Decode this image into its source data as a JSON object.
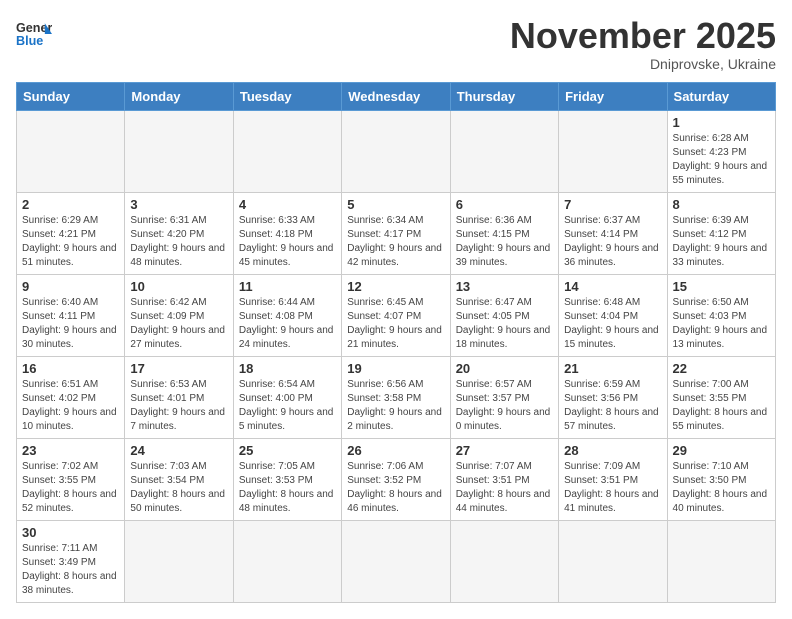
{
  "header": {
    "logo_line1": "General",
    "logo_line2": "Blue",
    "month_title": "November 2025",
    "location": "Dniprovske, Ukraine"
  },
  "weekdays": [
    "Sunday",
    "Monday",
    "Tuesday",
    "Wednesday",
    "Thursday",
    "Friday",
    "Saturday"
  ],
  "days": [
    {
      "date": "",
      "info": ""
    },
    {
      "date": "",
      "info": ""
    },
    {
      "date": "",
      "info": ""
    },
    {
      "date": "",
      "info": ""
    },
    {
      "date": "",
      "info": ""
    },
    {
      "date": "",
      "info": ""
    },
    {
      "date": "1",
      "info": "Sunrise: 6:28 AM\nSunset: 4:23 PM\nDaylight: 9 hours and 55 minutes."
    },
    {
      "date": "2",
      "info": "Sunrise: 6:29 AM\nSunset: 4:21 PM\nDaylight: 9 hours and 51 minutes."
    },
    {
      "date": "3",
      "info": "Sunrise: 6:31 AM\nSunset: 4:20 PM\nDaylight: 9 hours and 48 minutes."
    },
    {
      "date": "4",
      "info": "Sunrise: 6:33 AM\nSunset: 4:18 PM\nDaylight: 9 hours and 45 minutes."
    },
    {
      "date": "5",
      "info": "Sunrise: 6:34 AM\nSunset: 4:17 PM\nDaylight: 9 hours and 42 minutes."
    },
    {
      "date": "6",
      "info": "Sunrise: 6:36 AM\nSunset: 4:15 PM\nDaylight: 9 hours and 39 minutes."
    },
    {
      "date": "7",
      "info": "Sunrise: 6:37 AM\nSunset: 4:14 PM\nDaylight: 9 hours and 36 minutes."
    },
    {
      "date": "8",
      "info": "Sunrise: 6:39 AM\nSunset: 4:12 PM\nDaylight: 9 hours and 33 minutes."
    },
    {
      "date": "9",
      "info": "Sunrise: 6:40 AM\nSunset: 4:11 PM\nDaylight: 9 hours and 30 minutes."
    },
    {
      "date": "10",
      "info": "Sunrise: 6:42 AM\nSunset: 4:09 PM\nDaylight: 9 hours and 27 minutes."
    },
    {
      "date": "11",
      "info": "Sunrise: 6:44 AM\nSunset: 4:08 PM\nDaylight: 9 hours and 24 minutes."
    },
    {
      "date": "12",
      "info": "Sunrise: 6:45 AM\nSunset: 4:07 PM\nDaylight: 9 hours and 21 minutes."
    },
    {
      "date": "13",
      "info": "Sunrise: 6:47 AM\nSunset: 4:05 PM\nDaylight: 9 hours and 18 minutes."
    },
    {
      "date": "14",
      "info": "Sunrise: 6:48 AM\nSunset: 4:04 PM\nDaylight: 9 hours and 15 minutes."
    },
    {
      "date": "15",
      "info": "Sunrise: 6:50 AM\nSunset: 4:03 PM\nDaylight: 9 hours and 13 minutes."
    },
    {
      "date": "16",
      "info": "Sunrise: 6:51 AM\nSunset: 4:02 PM\nDaylight: 9 hours and 10 minutes."
    },
    {
      "date": "17",
      "info": "Sunrise: 6:53 AM\nSunset: 4:01 PM\nDaylight: 9 hours and 7 minutes."
    },
    {
      "date": "18",
      "info": "Sunrise: 6:54 AM\nSunset: 4:00 PM\nDaylight: 9 hours and 5 minutes."
    },
    {
      "date": "19",
      "info": "Sunrise: 6:56 AM\nSunset: 3:58 PM\nDaylight: 9 hours and 2 minutes."
    },
    {
      "date": "20",
      "info": "Sunrise: 6:57 AM\nSunset: 3:57 PM\nDaylight: 9 hours and 0 minutes."
    },
    {
      "date": "21",
      "info": "Sunrise: 6:59 AM\nSunset: 3:56 PM\nDaylight: 8 hours and 57 minutes."
    },
    {
      "date": "22",
      "info": "Sunrise: 7:00 AM\nSunset: 3:55 PM\nDaylight: 8 hours and 55 minutes."
    },
    {
      "date": "23",
      "info": "Sunrise: 7:02 AM\nSunset: 3:55 PM\nDaylight: 8 hours and 52 minutes."
    },
    {
      "date": "24",
      "info": "Sunrise: 7:03 AM\nSunset: 3:54 PM\nDaylight: 8 hours and 50 minutes."
    },
    {
      "date": "25",
      "info": "Sunrise: 7:05 AM\nSunset: 3:53 PM\nDaylight: 8 hours and 48 minutes."
    },
    {
      "date": "26",
      "info": "Sunrise: 7:06 AM\nSunset: 3:52 PM\nDaylight: 8 hours and 46 minutes."
    },
    {
      "date": "27",
      "info": "Sunrise: 7:07 AM\nSunset: 3:51 PM\nDaylight: 8 hours and 44 minutes."
    },
    {
      "date": "28",
      "info": "Sunrise: 7:09 AM\nSunset: 3:51 PM\nDaylight: 8 hours and 41 minutes."
    },
    {
      "date": "29",
      "info": "Sunrise: 7:10 AM\nSunset: 3:50 PM\nDaylight: 8 hours and 40 minutes."
    },
    {
      "date": "30",
      "info": "Sunrise: 7:11 AM\nSunset: 3:49 PM\nDaylight: 8 hours and 38 minutes."
    },
    {
      "date": "",
      "info": ""
    },
    {
      "date": "",
      "info": ""
    },
    {
      "date": "",
      "info": ""
    },
    {
      "date": "",
      "info": ""
    },
    {
      "date": "",
      "info": ""
    },
    {
      "date": "",
      "info": ""
    }
  ]
}
